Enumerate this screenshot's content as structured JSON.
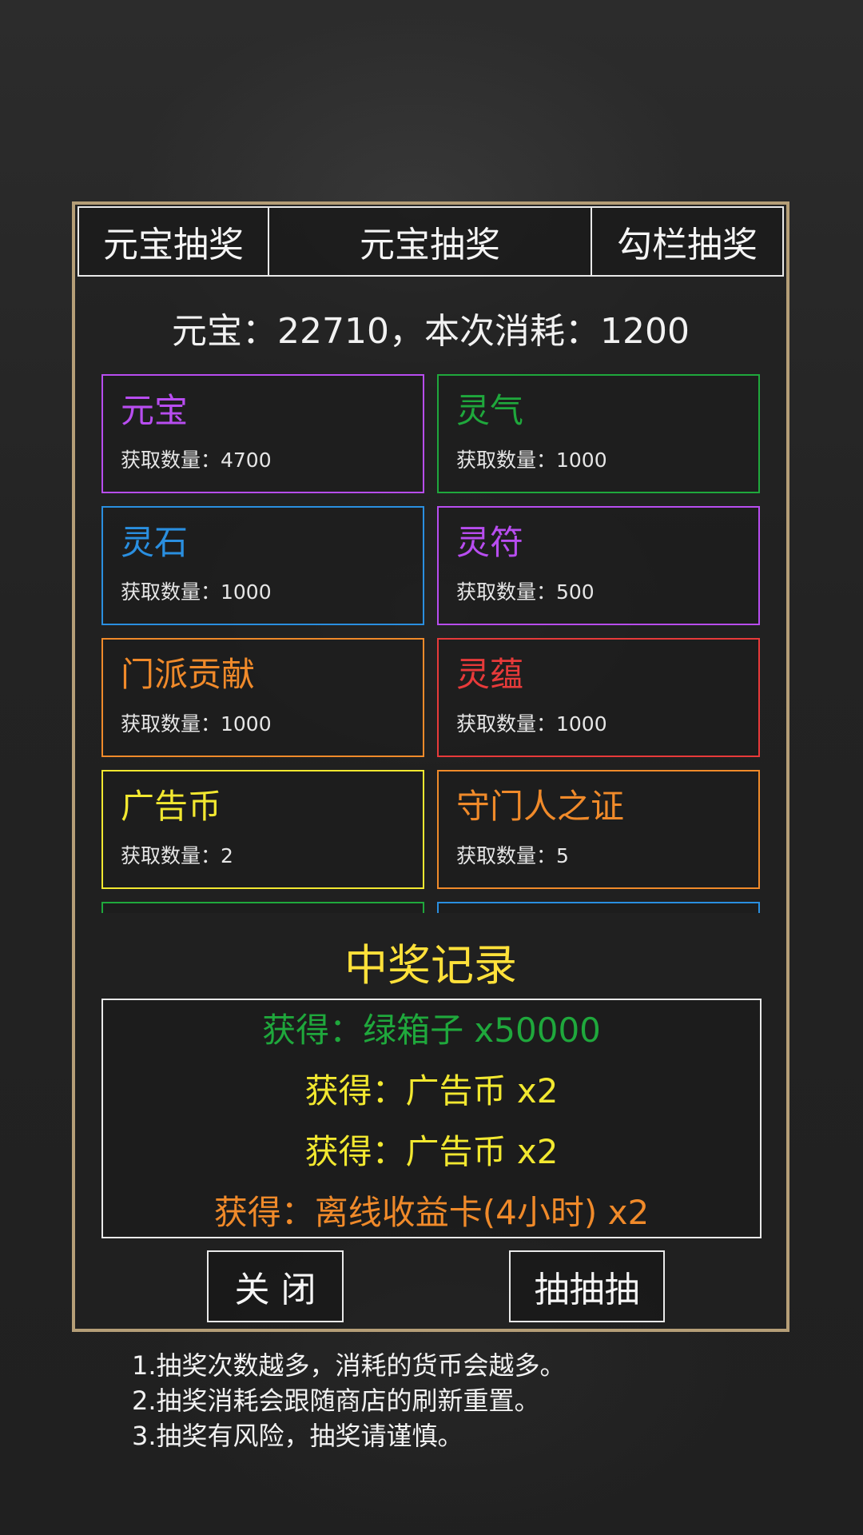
{
  "tabs": [
    {
      "label": "元宝抽奖"
    },
    {
      "label": "元宝抽奖"
    },
    {
      "label": "勾栏抽奖"
    }
  ],
  "currency_line": "元宝：22710，本次消耗：1200",
  "prizes": [
    {
      "name": "元宝",
      "qty": "获取数量：4700",
      "color": "#b84df0"
    },
    {
      "name": "灵气",
      "qty": "获取数量：1000",
      "color": "#1fa83c"
    },
    {
      "name": "灵石",
      "qty": "获取数量：1000",
      "color": "#2a8fe0"
    },
    {
      "name": "灵符",
      "qty": "获取数量：500",
      "color": "#b84df0"
    },
    {
      "name": "门派贡献",
      "qty": "获取数量：1000",
      "color": "#f08a2a"
    },
    {
      "name": "灵蕴",
      "qty": "获取数量：1000",
      "color": "#e83a3a"
    },
    {
      "name": "广告币",
      "qty": "获取数量：2",
      "color": "#f2e830"
    },
    {
      "name": "守门人之证",
      "qty": "获取数量：5",
      "color": "#f08a2a"
    },
    {
      "name": "",
      "qty": "",
      "color": "#1fa83c"
    },
    {
      "name": "",
      "qty": "",
      "color": "#2a8fe0"
    }
  ],
  "records_title": "中奖记录",
  "records": [
    {
      "text": "获得：绿箱子 x50000",
      "color": "#1fa83c"
    },
    {
      "text": "获得：广告币 x2",
      "color": "#f2e830"
    },
    {
      "text": "获得：广告币 x2",
      "color": "#f2e830"
    },
    {
      "text": "获得：离线收益卡(4小时) x2",
      "color": "#f08a2a"
    }
  ],
  "buttons": {
    "close_label": "关 闭",
    "draw_label": "抽抽抽"
  },
  "notes": [
    "1.抽奖次数越多，消耗的货币会越多。",
    "2.抽奖消耗会跟随商店的刷新重置。",
    "3.抽奖有风险，抽奖请谨慎。"
  ]
}
